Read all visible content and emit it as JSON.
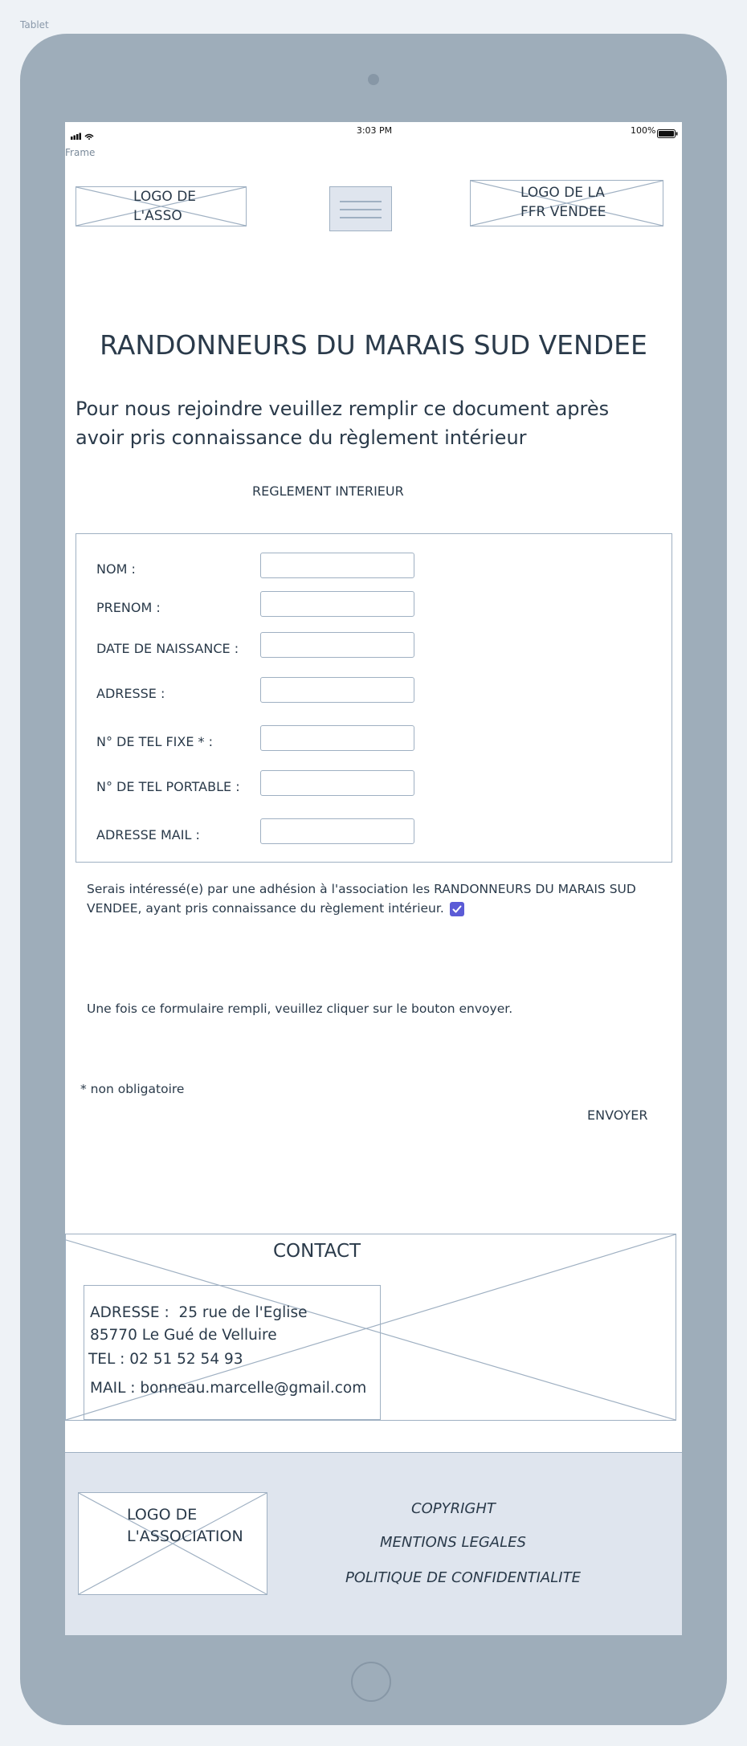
{
  "device": {
    "label": "Tablet"
  },
  "status_bar": {
    "time": "3:03 PM",
    "battery": "100%"
  },
  "frame_label": "Frame",
  "header": {
    "logo_left": {
      "line1": "LOGO DE",
      "line2": "L'ASSO"
    },
    "logo_right": {
      "line1": "LOGO DE LA",
      "line2": "FFR VENDEE"
    },
    "menu_icon": "hamburger-menu-icon"
  },
  "main": {
    "title": "RANDONNEURS DU MARAIS SUD VENDEE",
    "intro_line1": "Pour nous rejoindre veuillez remplir ce document après",
    "intro_line2": "avoir pris connaissance du règlement intérieur",
    "reglement_link": "REGLEMENT INTERIEUR"
  },
  "form": {
    "fields": [
      {
        "label": "NOM :",
        "value": ""
      },
      {
        "label": "PRENOM :",
        "value": ""
      },
      {
        "label": "DATE DE NAISSANCE :",
        "value": ""
      },
      {
        "label": "ADRESSE :",
        "value": ""
      },
      {
        "label": "N° DE TEL FIXE * :",
        "value": ""
      },
      {
        "label": "N° DE TEL PORTABLE :",
        "value": ""
      },
      {
        "label": "ADRESSE MAIL :",
        "value": ""
      }
    ],
    "consent_line1": "Serais intéressé(e) par une adhésion à l'association les RANDONNEURS DU MARAIS SUD",
    "consent_line2": "VENDEE, ayant pris connaissance du règlement intérieur.",
    "consent_checked": true,
    "instruction": "Une fois ce formulaire rempli, veuillez cliquer sur le bouton envoyer.",
    "note": "* non obligatoire",
    "submit_label": "ENVOYER"
  },
  "contact": {
    "title": "CONTACT",
    "address_line1": "ADRESSE :  25 rue de l'Eglise",
    "address_line2": "85770 Le Gué de Velluire",
    "tel": "TEL : 02 51 52 54 93",
    "mail": "MAIL : bonneau.marcelle@gmail.com"
  },
  "footer": {
    "logo": {
      "line1": "LOGO DE",
      "line2": "L'ASSOCIATION"
    },
    "links": [
      "COPYRIGHT",
      "MENTIONS LEGALES",
      "POLITIQUE DE CONFIDENTIALITE"
    ]
  },
  "colors": {
    "accent": "#5b5bd6",
    "border": "#9fb0c2",
    "footer_bg": "#dfe5ee",
    "device_body": "#9eadba"
  }
}
